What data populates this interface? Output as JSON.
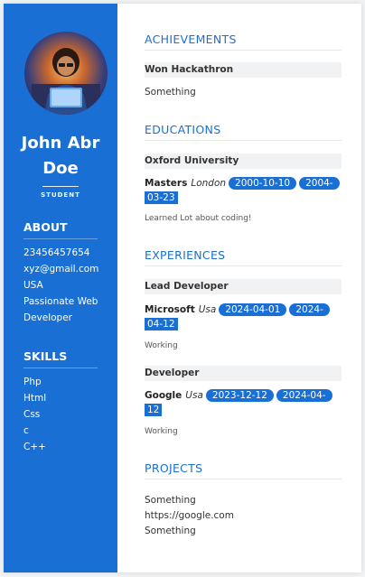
{
  "profile": {
    "name_line1": "John Abr",
    "name_line2": "Doe",
    "role": "STUDENT"
  },
  "about": {
    "heading": "ABOUT",
    "items": [
      "23456457654",
      "xyz@gmail.com",
      "USA",
      "Passionate Web",
      "Developer"
    ]
  },
  "skills": {
    "heading": "SKILLS",
    "items": [
      "Php",
      "Html",
      "Css",
      "c",
      "C++"
    ]
  },
  "achievements": {
    "heading": "ACHIEVEMENTS",
    "title": "Won Hackathron",
    "description": "Something"
  },
  "educations": {
    "heading": "EDUCATIONS",
    "institution": "Oxford University",
    "degree": "Masters",
    "location": "London",
    "start": "2000-10-10",
    "end_part1": "2004-",
    "end_part2": "03-23",
    "description": "Learned Lot about coding!"
  },
  "experiences": {
    "heading": "EXPERIENCES",
    "items": [
      {
        "role": "Lead Developer",
        "company": "Microsoft",
        "location": "Usa",
        "start": "2024-04-01",
        "end_part1": "2024-",
        "end_part2": "04-12",
        "description": "Working"
      },
      {
        "role": "Developer",
        "company": "Google",
        "location": "Usa",
        "start": "2023-12-12",
        "end_part1": "2024-04-",
        "end_part2": "12",
        "description": "Working"
      }
    ]
  },
  "projects": {
    "heading": "PROJECTS",
    "lines": [
      "Something",
      "https://google.com",
      "Something"
    ]
  },
  "colors": {
    "accent": "#1a6fd4",
    "sidebar": "#1a6fd4"
  }
}
